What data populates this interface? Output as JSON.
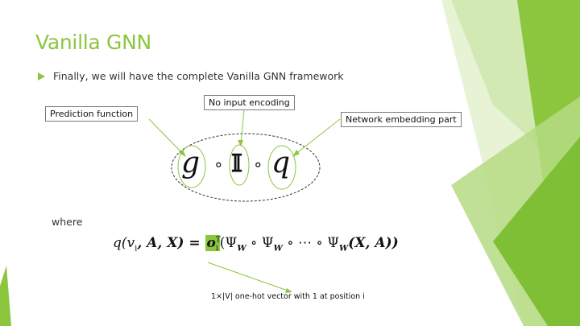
{
  "slide": {
    "title": "Vanilla GNN",
    "bullet": "Finally, we will have the complete Vanilla GNN framework",
    "callouts": {
      "prediction": "Prediction function",
      "no_input": "No input encoding",
      "network_embedding": "Network embedding part"
    },
    "composition": {
      "g": "g",
      "compose1": "∘",
      "identity": "𝕀",
      "compose2": "∘",
      "q": "q"
    },
    "where_label": "where",
    "formula": {
      "lhs": "q(v",
      "lhs_sub": "i",
      "lhs_rest": ", A, X) = ",
      "o_var": "o",
      "o_sup": "T",
      "o_sub": "i",
      "rhs": "(Ψ",
      "rhs_sub1": "W",
      "rhs_mid1": " ∘  Ψ",
      "rhs_sub2": "W",
      "rhs_mid2": " ∘ ⋯ ∘ Ψ",
      "rhs_sub3": "W",
      "rhs_end": "(X, A))"
    },
    "note": "1×|V| one-hot vector with 1 at position i"
  },
  "colors": {
    "accent": "#8cc63f",
    "accent_dark": "#6aa62a",
    "accent_light": "#c8e39f"
  }
}
